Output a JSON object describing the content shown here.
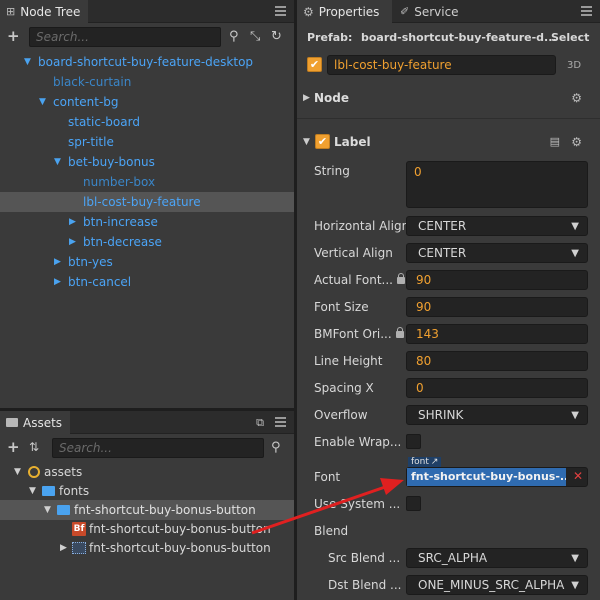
{
  "node_tree": {
    "tab_label": "Node Tree",
    "search_placeholder": "Search...",
    "items": [
      {
        "label": "board-shortcut-buy-feature-desktop",
        "expander": "▼"
      },
      {
        "label": "black-curtain"
      },
      {
        "label": "content-bg",
        "expander": "▼"
      },
      {
        "label": "static-board"
      },
      {
        "label": "spr-title"
      },
      {
        "label": "bet-buy-bonus",
        "expander": "▼"
      },
      {
        "label": "number-box"
      },
      {
        "label": "lbl-cost-buy-feature"
      },
      {
        "label": "btn-increase",
        "expander": "▶"
      },
      {
        "label": "btn-decrease",
        "expander": "▶"
      },
      {
        "label": "btn-yes",
        "expander": "▶"
      },
      {
        "label": "btn-cancel",
        "expander": "▶"
      }
    ]
  },
  "assets": {
    "tab_label": "Assets",
    "search_placeholder": "Search...",
    "items": [
      {
        "label": "assets",
        "expander": "▼"
      },
      {
        "label": "fonts",
        "expander": "▼"
      },
      {
        "label": "fnt-shortcut-buy-bonus-button",
        "expander": "▼"
      },
      {
        "label": "fnt-shortcut-buy-bonus-button",
        "badge": "Bf"
      },
      {
        "label": "fnt-shortcut-buy-bonus-button",
        "expander": "▶"
      }
    ]
  },
  "properties": {
    "tab_label": "Properties",
    "service_tab_label": "Service",
    "prefab_label": "Prefab:",
    "prefab_value": "board-shortcut-buy-feature-d...",
    "select_label": "Select",
    "node_name": "lbl-cost-buy-feature",
    "mode_3d": "3D",
    "node_section": "Node",
    "label_section": "Label",
    "string_label": "String",
    "string_value": "0",
    "h_align_label": "Horizontal Align",
    "h_align_value": "CENTER",
    "v_align_label": "Vertical Align",
    "v_align_value": "CENTER",
    "actual_font_label": "Actual Font...",
    "actual_font_value": "90",
    "font_size_label": "Font Size",
    "font_size_value": "90",
    "bmfont_label": "BMFont Ori...",
    "bmfont_value": "143",
    "line_height_label": "Line Height",
    "line_height_value": "80",
    "spacing_x_label": "Spacing X",
    "spacing_x_value": "0",
    "overflow_label": "Overflow",
    "overflow_value": "SHRINK",
    "enable_wrap_label": "Enable Wrap...",
    "font_label": "Font",
    "font_tag": "font",
    "font_value": "fnt-shortcut-buy-bonus-...",
    "use_system_label": "Use System ...",
    "blend_label": "Blend",
    "src_blend_label": "Src Blend ...",
    "src_blend_value": "SRC_ALPHA",
    "dst_blend_label": "Dst Blend ...",
    "dst_blend_value": "ONE_MINUS_SRC_ALPHA"
  },
  "colors": {
    "accent_orange": "#f0a030",
    "tree_blue": "#4ba4f6",
    "annotation_red": "#e02020"
  }
}
